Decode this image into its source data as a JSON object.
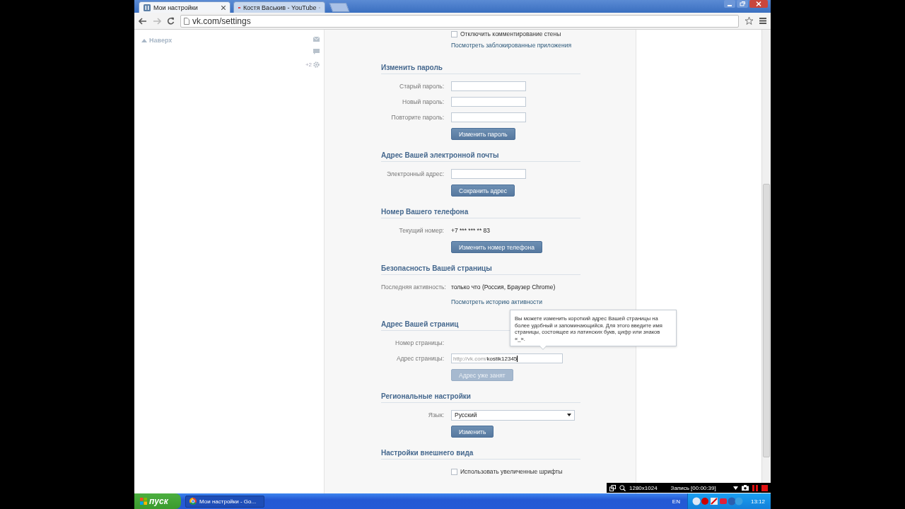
{
  "browser": {
    "tabs": [
      {
        "title": "Мои настройки",
        "selected": true
      },
      {
        "title": "Костя Васькив - YouTube",
        "selected": false
      }
    ],
    "address": "vk.com/settings"
  },
  "sidebar": {
    "top_link": "Наверх",
    "counter": "+2"
  },
  "settings": {
    "top_rows": [
      {
        "kind": "checkbox",
        "label": "Отключить комментирование стены",
        "checked": false
      },
      {
        "kind": "link",
        "text": "Посмотреть заблокированные приложения"
      }
    ],
    "sections": [
      {
        "title": "Изменить пароль",
        "rows": [
          {
            "kind": "field",
            "label": "Старый пароль:"
          },
          {
            "kind": "field",
            "label": "Новый пароль:"
          },
          {
            "kind": "field",
            "label": "Повторите пароль:"
          },
          {
            "kind": "button",
            "text": "Изменить пароль",
            "disabled": false
          }
        ]
      },
      {
        "title": "Адрес Вашей электронной почты",
        "rows": [
          {
            "kind": "field",
            "label": "Электронный адрес:"
          },
          {
            "kind": "button",
            "text": "Сохранить адрес",
            "disabled": false
          }
        ]
      },
      {
        "title": "Номер Вашего телефона",
        "rows": [
          {
            "kind": "text",
            "label": "Текущий номер:",
            "value": "+7 *** *** ** 83"
          },
          {
            "kind": "button",
            "text": "Изменить номер телефона",
            "disabled": false
          }
        ]
      },
      {
        "title": "Безопасность Вашей страницы",
        "rows": [
          {
            "kind": "text",
            "label": "Последняя активность:",
            "value": "только что (Россия, Браузер Chrome)"
          },
          {
            "kind": "link",
            "text": "Посмотреть историю активности"
          }
        ]
      },
      {
        "title": "Адрес Вашей страниц",
        "tooltip": "Вы можете изменить короткий адрес Вашей страницы на более удобный и запоминающийся. Для этого введите имя страницы, состоящее из латинских букв, цифр или знаков «_».",
        "rows": [
          {
            "kind": "label",
            "label": "Номер страницы:"
          },
          {
            "kind": "address",
            "label": "Адрес страницы:",
            "prefix": "http://vk.com/",
            "value": "kostik12345"
          },
          {
            "kind": "button",
            "text": "Адрес уже занят",
            "disabled": true
          }
        ]
      },
      {
        "title": "Региональные настройки",
        "rows": [
          {
            "kind": "dropdown",
            "label": "Язык:",
            "value": "Русский"
          },
          {
            "kind": "button",
            "text": "Изменить",
            "disabled": false
          }
        ]
      },
      {
        "title": "Настройки внешнего вида",
        "rows": [
          {
            "kind": "checkbox",
            "label": "Использовать увеличенные шрифты",
            "checked": false
          }
        ]
      }
    ]
  },
  "recorder": {
    "resolution": "1280x1024",
    "status": "Запись [00:00:39]"
  },
  "taskbar": {
    "start": "пуск",
    "tasks": [
      {
        "title": "Мои настройки - Go...",
        "selected": true
      }
    ],
    "language": "EN",
    "clock": "13:12"
  }
}
